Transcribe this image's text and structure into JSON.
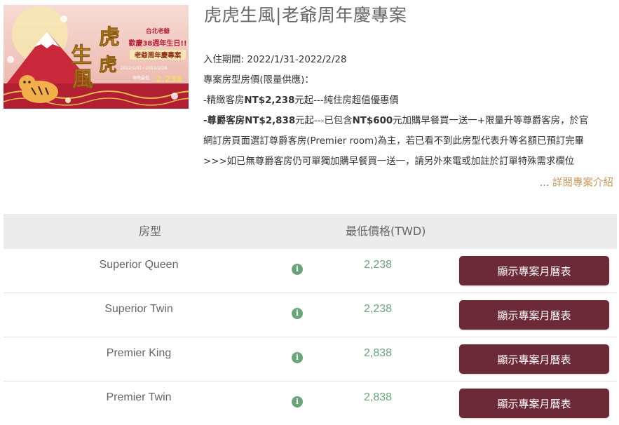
{
  "banner": {
    "big_text": "虎虎生風",
    "badge_line1": "台北老爺",
    "badge_line2": "歡慶38週年生日!!",
    "plan_label": "老爺周年慶專案",
    "small_text": "2022/1/31~2022/2/28",
    "price_prefix": "每晚最低",
    "price": "2,238",
    "price_suffix": "元起"
  },
  "title": "虎虎生風|老爺周年慶專案",
  "description": {
    "period_label": "入住期間: ",
    "period_value": "2022/1/31-2022/2/28",
    "rate_heading": "專案房型房價(限量供應)：",
    "line1_prefix": "-精緻客房",
    "line1_price": "NT$2,238",
    "line1_rest": "元起---純住房超值優惠價",
    "line2_prefix": "-尊爵客房",
    "line2_price": "NT$2,838",
    "line2_mid": "元起---已包含",
    "line2_bold2": "NT$600",
    "line2_rest": "元加購早餐買一送一+限量升等尊爵客房，於官",
    "line3": "網訂房頁面選訂尊爵客房(Premier room)為主，若已看不到此房型代表升等名額已預訂完畢",
    "line4": ">>>如已無尊爵客房仍可單獨加購早餐買一送一，請另外來電或加註於訂單特殊需求欄位"
  },
  "more": {
    "ellipsis": "...",
    "link": "詳閱專案介紹"
  },
  "table": {
    "col_room": "房型",
    "col_price": "最低價格(TWD)",
    "rows": [
      {
        "room": "Superior Queen",
        "price": "2,238",
        "button": "顯示專案月曆表"
      },
      {
        "room": "Superior Twin",
        "price": "2,238",
        "button": "顯示專案月曆表"
      },
      {
        "room": "Premier King",
        "price": "2,838",
        "button": "顯示專案月曆表"
      },
      {
        "room": "Premier Twin",
        "price": "2,838",
        "button": "顯示專案月曆表"
      }
    ]
  },
  "icons": {
    "info": "info-icon"
  },
  "colors": {
    "button_bg": "#6b2a35",
    "price_green": "#6aa57a",
    "link_gold": "#c9975a",
    "header_bg": "#ececec"
  }
}
